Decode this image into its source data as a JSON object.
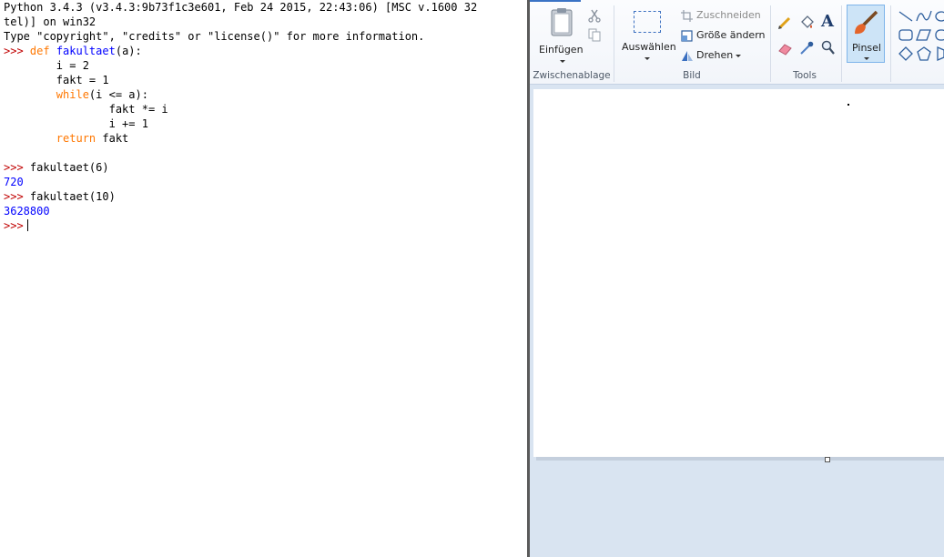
{
  "shell": {
    "lines": [
      {
        "parts": [
          {
            "t": "Python 3.4.3 (v3.4.3:9b73f1c3e601, Feb 24 2015, 22:43:06) [MSC v.1600 32",
            "c": ""
          }
        ]
      },
      {
        "parts": [
          {
            "t": "tel)] on win32",
            "c": ""
          }
        ]
      },
      {
        "parts": [
          {
            "t": "Type \"copyright\", \"credits\" or \"license()\" for more information.",
            "c": ""
          }
        ]
      },
      {
        "parts": [
          {
            "t": ">>> ",
            "c": "prompt"
          },
          {
            "t": "def ",
            "c": "kw"
          },
          {
            "t": "fakultaet",
            "c": "fn"
          },
          {
            "t": "(a):",
            "c": ""
          }
        ]
      },
      {
        "parts": [
          {
            "t": "        i = 2",
            "c": ""
          }
        ]
      },
      {
        "parts": [
          {
            "t": "        fakt = 1",
            "c": ""
          }
        ]
      },
      {
        "parts": [
          {
            "t": "        ",
            "c": ""
          },
          {
            "t": "while",
            "c": "kw"
          },
          {
            "t": "(i <= a):",
            "c": ""
          }
        ]
      },
      {
        "parts": [
          {
            "t": "                fakt *= i",
            "c": ""
          }
        ]
      },
      {
        "parts": [
          {
            "t": "                i += 1",
            "c": ""
          }
        ]
      },
      {
        "parts": [
          {
            "t": "        ",
            "c": ""
          },
          {
            "t": "return",
            "c": "kw"
          },
          {
            "t": " fakt",
            "c": ""
          }
        ]
      },
      {
        "parts": [
          {
            "t": "",
            "c": ""
          }
        ]
      },
      {
        "parts": [
          {
            "t": ">>> ",
            "c": "prompt"
          },
          {
            "t": "fakultaet(6)",
            "c": ""
          }
        ]
      },
      {
        "parts": [
          {
            "t": "720",
            "c": "out"
          }
        ]
      },
      {
        "parts": [
          {
            "t": ">>> ",
            "c": "prompt"
          },
          {
            "t": "fakultaet(10)",
            "c": ""
          }
        ]
      },
      {
        "parts": [
          {
            "t": "3628800",
            "c": "out"
          }
        ]
      },
      {
        "parts": [
          {
            "t": ">>>",
            "c": "prompt"
          }
        ]
      }
    ]
  },
  "ribbon": {
    "clipboard": {
      "paste": "Einfügen",
      "group": "Zwischenablage"
    },
    "image": {
      "select": "Auswählen",
      "crop": "Zuschneiden",
      "resize": "Größe ändern",
      "rotate": "Drehen",
      "group": "Bild"
    },
    "tools": {
      "group": "Tools"
    },
    "brush": {
      "label": "Pinsel"
    }
  },
  "icons": {
    "paste": "clipboard-icon",
    "cut": "scissors-icon",
    "copy": "copy-icon",
    "select": "selection-rectangle-icon",
    "crop": "crop-icon",
    "resize": "resize-icon",
    "rotate": "rotate-icon",
    "pencil": "pencil-icon",
    "fill": "fill-bucket-icon",
    "text": "text-icon",
    "eraser": "eraser-icon",
    "picker": "color-picker-icon",
    "zoom": "magnifier-icon",
    "brush": "brush-icon",
    "shapes": "shapes-gallery"
  },
  "colors": {
    "prompt": "#c00000",
    "keyword": "#ff7700",
    "function": "#0000ff",
    "output": "#0000ff",
    "ribbon_active": "#cde4f7"
  }
}
